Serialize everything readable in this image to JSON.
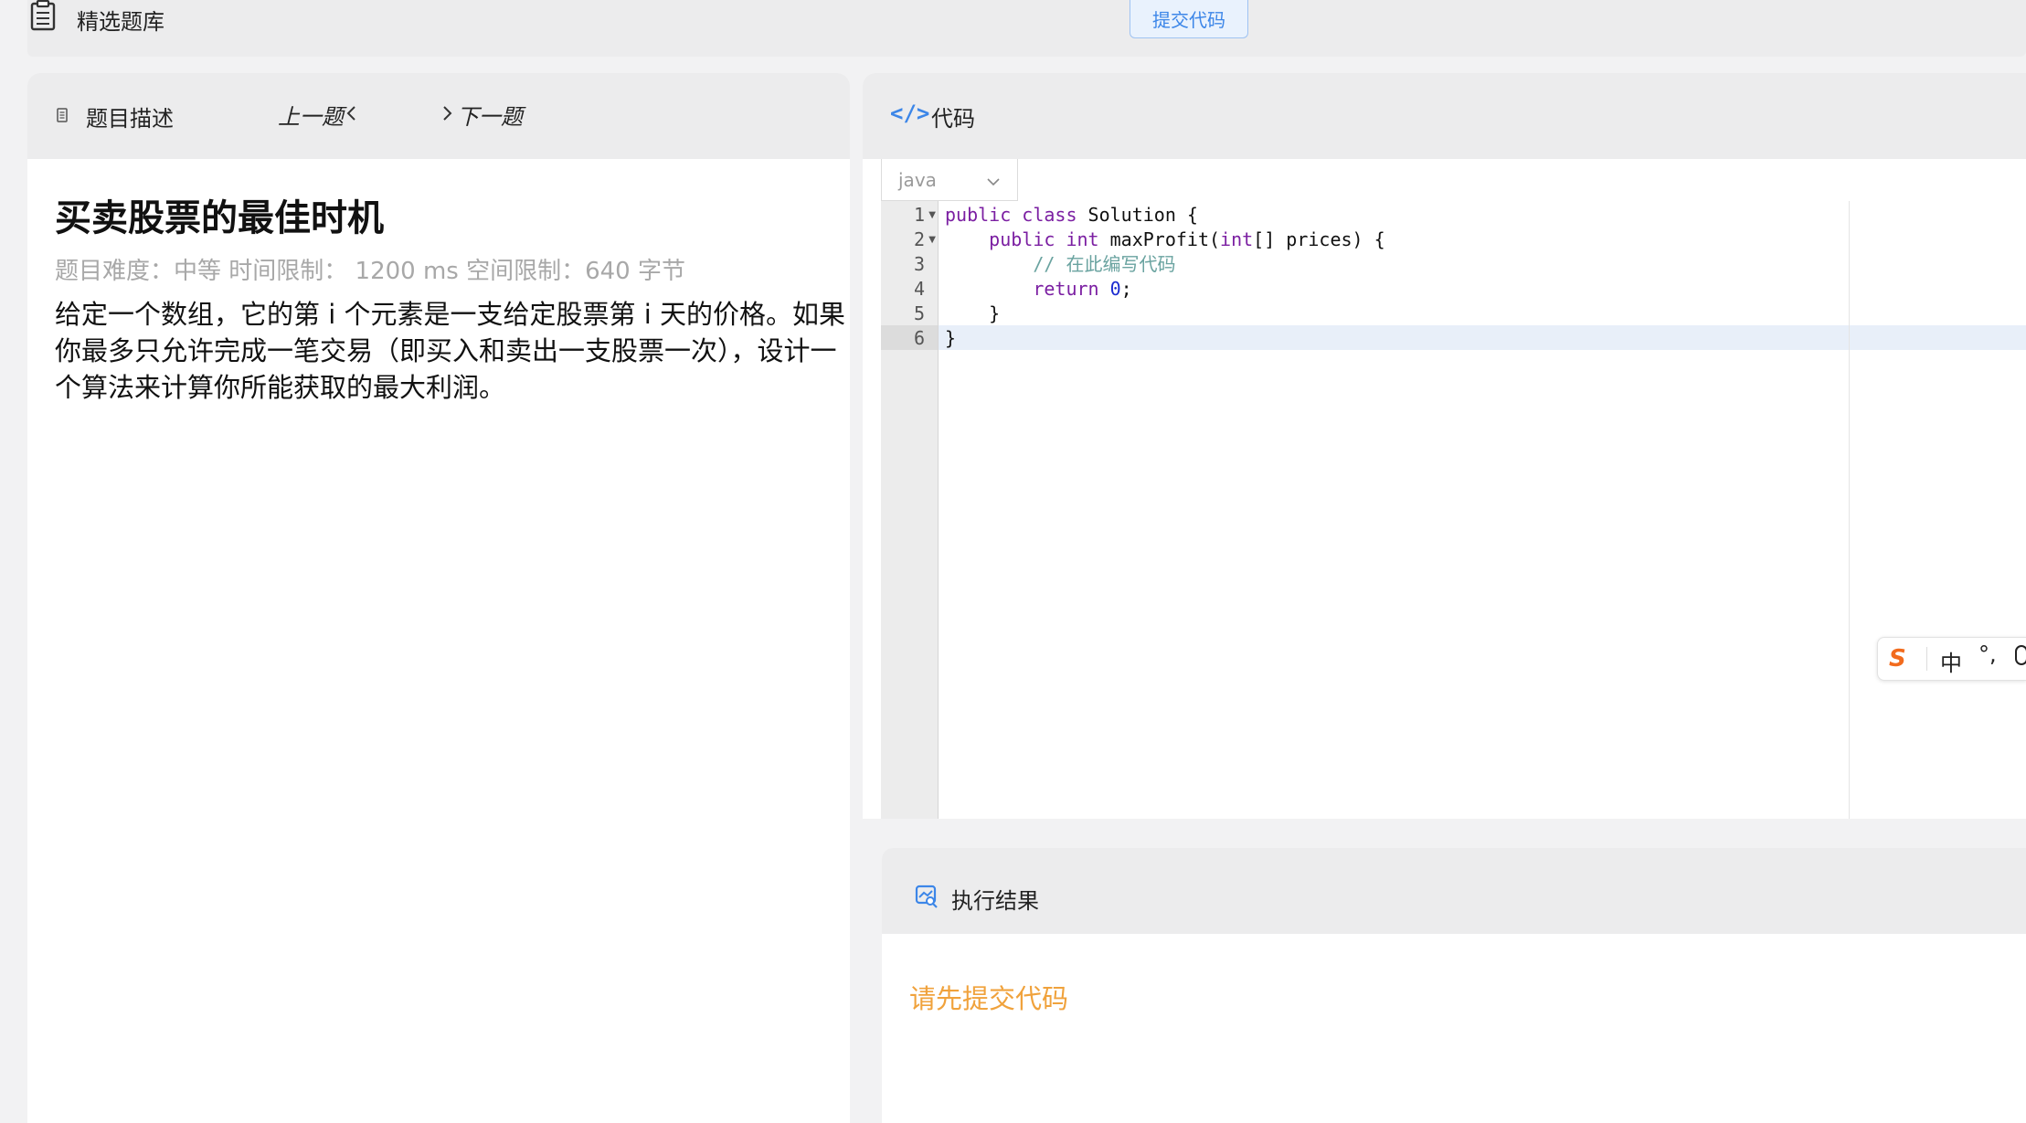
{
  "topbar": {
    "bank_label": "精选题库",
    "submit_label": "提交代码"
  },
  "problem": {
    "tab_label": "题目描述",
    "prev_label": "上一题",
    "next_label": "下一题",
    "title": "买卖股票的最佳时机",
    "meta": "题目难度：中等 时间限制： 1200 ms 空间限制：640 字节",
    "description": "给定一个数组，它的第 i 个元素是一支给定股票第 i 天的价格。如果你最多只允许完成一笔交易（即买入和卖出一支股票一次），设计一个算法来计算你所能获取的最大利润。"
  },
  "editor": {
    "header_label": "代码",
    "language": "java",
    "line_numbers": [
      "1",
      "2",
      "3",
      "4",
      "5",
      "6"
    ],
    "lines": {
      "l1_kw": "public class",
      "l1_rest": " Solution {",
      "l2_kw1": "public int",
      "l2_mid": " maxProfit(",
      "l2_kw2": "int",
      "l2_rest": "[] prices) {",
      "l3_comment": "// 在此编写代码",
      "l4_kw": "return",
      "l4_num": "0",
      "l4_end": ";",
      "l5": "}",
      "l6": "}"
    },
    "active_line": 6
  },
  "ime": {
    "logo": "S",
    "mode": "中",
    "punct": "°,"
  },
  "result": {
    "header_label": "执行结果",
    "message": "请先提交代码"
  },
  "colors": {
    "accent": "#3c86e8",
    "warning": "#f0a23c",
    "ime_logo": "#f26b1d"
  }
}
